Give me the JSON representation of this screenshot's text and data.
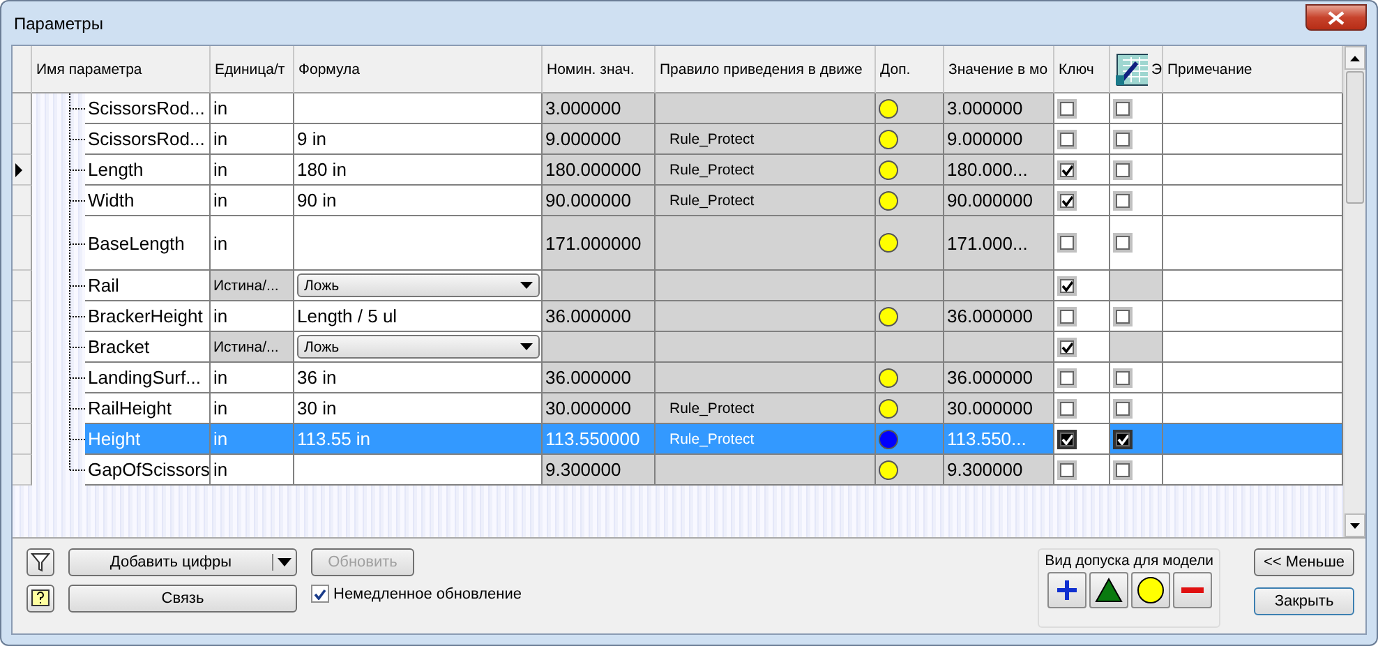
{
  "window": {
    "title": "Параметры"
  },
  "table": {
    "columns": [
      {
        "label": "Имя параметра",
        "icon": false
      },
      {
        "label": "Единица/т",
        "icon": false
      },
      {
        "label": "Формула",
        "icon": false
      },
      {
        "label": "Номин. знач.",
        "icon": false
      },
      {
        "label": "Правило приведения в движе",
        "icon": false
      },
      {
        "label": "Доп.",
        "icon": false
      },
      {
        "label": "Значение в мо",
        "icon": false
      },
      {
        "label": "Ключ",
        "icon": false
      },
      {
        "label": "Э",
        "icon": true
      },
      {
        "label": "Примечание",
        "icon": false
      }
    ],
    "rows": [
      {
        "kind": "numeric",
        "name": "ScissorsRod...",
        "unit": "in",
        "formula": "",
        "nominal": "3.000000",
        "rule": "",
        "color": "#ffff00",
        "model_value": "3.000000",
        "key": false,
        "export": false,
        "selected": false,
        "current": false,
        "tall": false
      },
      {
        "kind": "numeric",
        "name": "ScissorsRod...",
        "unit": "in",
        "formula": "9 in",
        "nominal": "9.000000",
        "rule": "Rule_Protect",
        "color": "#ffff00",
        "model_value": "9.000000",
        "key": false,
        "export": false,
        "selected": false,
        "current": false,
        "tall": false
      },
      {
        "kind": "numeric",
        "name": "Length",
        "unit": "in",
        "formula": "180 in",
        "nominal": "180.000000",
        "rule": "Rule_Protect",
        "color": "#ffff00",
        "model_value": "180.000...",
        "key": true,
        "export": false,
        "selected": false,
        "current": true,
        "tall": false
      },
      {
        "kind": "numeric",
        "name": "Width",
        "unit": "in",
        "formula": "90 in",
        "nominal": "90.000000",
        "rule": "Rule_Protect",
        "color": "#ffff00",
        "model_value": "90.000000",
        "key": true,
        "export": false,
        "selected": false,
        "current": false,
        "tall": false
      },
      {
        "kind": "numeric",
        "name": "BaseLength",
        "unit": "in",
        "formula": "",
        "nominal": "171.000000",
        "rule": "",
        "color": "#ffff00",
        "model_value": "171.000...",
        "key": false,
        "export": false,
        "selected": false,
        "current": false,
        "tall": true
      },
      {
        "kind": "boolean",
        "name": "Rail",
        "unit": "Истина/...",
        "formula": "Ложь",
        "key": true,
        "selected": false,
        "current": false,
        "tall": false
      },
      {
        "kind": "numeric",
        "name": "BrackerHeight",
        "unit": "in",
        "formula": "Length / 5 ul",
        "nominal": "36.000000",
        "rule": "",
        "color": "#ffff00",
        "model_value": "36.000000",
        "key": false,
        "export": false,
        "selected": false,
        "current": false,
        "tall": false
      },
      {
        "kind": "boolean",
        "name": "Bracket",
        "unit": "Истина/...",
        "formula": "Ложь",
        "key": true,
        "selected": false,
        "current": false,
        "tall": false
      },
      {
        "kind": "numeric",
        "name": "LandingSurf...",
        "unit": "in",
        "formula": "36 in",
        "nominal": "36.000000",
        "rule": "",
        "color": "#ffff00",
        "model_value": "36.000000",
        "key": false,
        "export": false,
        "selected": false,
        "current": false,
        "tall": false
      },
      {
        "kind": "numeric",
        "name": "RailHeight",
        "unit": "in",
        "formula": "30 in",
        "nominal": "30.000000",
        "rule": "Rule_Protect",
        "color": "#ffff00",
        "model_value": "30.000000",
        "key": false,
        "export": false,
        "selected": false,
        "current": false,
        "tall": false
      },
      {
        "kind": "numeric",
        "name": "Height",
        "unit": "in",
        "formula": "113.55 in",
        "nominal": "113.550000",
        "rule": "Rule_Protect",
        "color": "#0000ff",
        "model_value": "113.550...",
        "key": true,
        "export": true,
        "selected": true,
        "current": false,
        "tall": false
      },
      {
        "kind": "numeric",
        "name": "GapOfScissors",
        "unit": "in",
        "formula": "",
        "nominal": "9.300000",
        "rule": "",
        "color": "#ffff00",
        "model_value": "9.300000",
        "key": false,
        "export": false,
        "selected": false,
        "current": false,
        "tall": false
      }
    ]
  },
  "footer": {
    "add_button": "Добавить цифры",
    "link_button": "Связь",
    "update_button": {
      "label": "Обновить",
      "disabled": true
    },
    "immediate_update": {
      "label": "Немедленное обновление",
      "checked": true
    },
    "tolerance_group": {
      "title": "Вид допуска для модели",
      "buttons": [
        {
          "kind": "plus"
        },
        {
          "kind": "triangle"
        },
        {
          "kind": "circle"
        },
        {
          "kind": "minus"
        }
      ]
    },
    "less_button": "<< Меньше",
    "close_button": "Закрыть"
  }
}
